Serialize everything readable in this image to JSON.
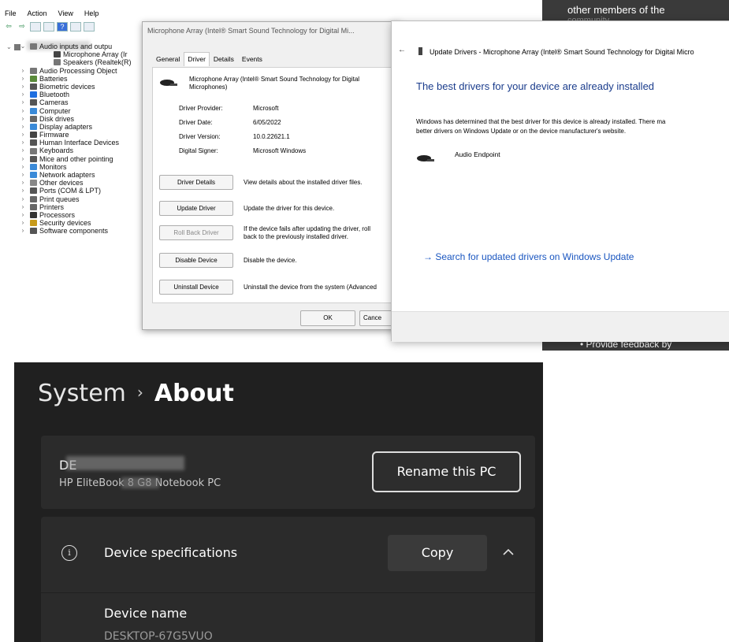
{
  "device_manager": {
    "menu": [
      "File",
      "Action",
      "View",
      "Help"
    ],
    "tree": [
      {
        "label": "Audio inputs and outpu",
        "level": 1,
        "expanded": true,
        "icon": "speaker-icon"
      },
      {
        "label": "Microphone Array (Ir",
        "level": 2,
        "icon": "microphone-icon"
      },
      {
        "label": "Speakers (Realtek(R)",
        "level": 2,
        "icon": "speaker-icon"
      },
      {
        "label": "Audio Processing Object",
        "level": 1,
        "icon": "speaker-icon"
      },
      {
        "label": "Batteries",
        "level": 1,
        "icon": "battery-icon"
      },
      {
        "label": "Biometric devices",
        "level": 1,
        "icon": "fingerprint-icon"
      },
      {
        "label": "Bluetooth",
        "level": 1,
        "icon": "bluetooth-icon"
      },
      {
        "label": "Cameras",
        "level": 1,
        "icon": "camera-icon"
      },
      {
        "label": "Computer",
        "level": 1,
        "icon": "computer-icon"
      },
      {
        "label": "Disk drives",
        "level": 1,
        "icon": "disk-icon"
      },
      {
        "label": "Display adapters",
        "level": 1,
        "icon": "display-icon"
      },
      {
        "label": "Firmware",
        "level": 1,
        "icon": "firmware-icon"
      },
      {
        "label": "Human Interface Devices",
        "level": 1,
        "icon": "hid-icon"
      },
      {
        "label": "Keyboards",
        "level": 1,
        "icon": "keyboard-icon"
      },
      {
        "label": "Mice and other pointing",
        "level": 1,
        "icon": "mouse-icon"
      },
      {
        "label": "Monitors",
        "level": 1,
        "icon": "monitor-icon"
      },
      {
        "label": "Network adapters",
        "level": 1,
        "icon": "network-icon"
      },
      {
        "label": "Other devices",
        "level": 1,
        "icon": "other-devices-icon"
      },
      {
        "label": "Ports (COM & LPT)",
        "level": 1,
        "icon": "port-icon"
      },
      {
        "label": "Print queues",
        "level": 1,
        "icon": "printer-icon"
      },
      {
        "label": "Printers",
        "level": 1,
        "icon": "printer-icon"
      },
      {
        "label": "Processors",
        "level": 1,
        "icon": "processor-icon"
      },
      {
        "label": "Security devices",
        "level": 1,
        "icon": "security-icon"
      },
      {
        "label": "Software components",
        "level": 1,
        "icon": "software-icon"
      }
    ]
  },
  "sidebar": {
    "line1": "other members of the",
    "line2": "community",
    "bullet": "Provide feedback by"
  },
  "properties": {
    "title": "Microphone Array (Intel® Smart Sound Technology for Digital Mi...",
    "tabs": [
      "General",
      "Driver",
      "Details",
      "Events"
    ],
    "device_name_line1": "Microphone Array (Intel® Smart Sound Technology for Digital",
    "device_name_line2": "Microphones)",
    "provider_label": "Driver Provider:",
    "provider_value": "Microsoft",
    "date_label": "Driver Date:",
    "date_value": "6/05/2022",
    "version_label": "Driver Version:",
    "version_value": "10.0.22621.1",
    "signer_label": "Digital Signer:",
    "signer_value": "Microsoft Windows",
    "buttons": [
      {
        "label": "Driver Details",
        "desc": "View details about the installed driver files.",
        "desc2": ""
      },
      {
        "label": "Update Driver",
        "desc": "Update the driver for this device.",
        "desc2": ""
      },
      {
        "label": "Roll Back Driver",
        "desc": "If the device fails after updating the driver, roll",
        "desc2": "back to the previously installed driver."
      },
      {
        "label": "Disable Device",
        "desc": "Disable the device.",
        "desc2": ""
      },
      {
        "label": "Uninstall Device",
        "desc": "Uninstall the device from the system (Advanced",
        "desc2": ""
      }
    ],
    "ok_label": "OK",
    "cancel_label": "Cance"
  },
  "update_drivers": {
    "back_glyph": "←",
    "title": "Update Drivers - Microphone Array (Intel® Smart Sound Technology for Digital Micro",
    "heading": "The best drivers for your device are already installed",
    "body_line1": "Windows has determined that the best driver for this device is already installed. There ma",
    "body_line2": "better drivers on Windows Update or on the device manufacturer's website.",
    "device": "Audio Endpoint",
    "link": "→  Search for updated drivers on Windows Update"
  },
  "settings": {
    "breadcrumb_parent": "System",
    "breadcrumb_sep": "›",
    "breadcrumb_current": "About",
    "pc_name_partial": "DE",
    "pc_model": "HP EliteBook 8 G8 Notebook PC",
    "rename_label": "Rename this PC",
    "specs_title": "Device specifications",
    "copy_label": "Copy",
    "device_name_label": "Device name",
    "device_name_value": "DESKTOP-67G5VUO",
    "accent": "#4cc2ff",
    "link_color": "#0067c0"
  }
}
